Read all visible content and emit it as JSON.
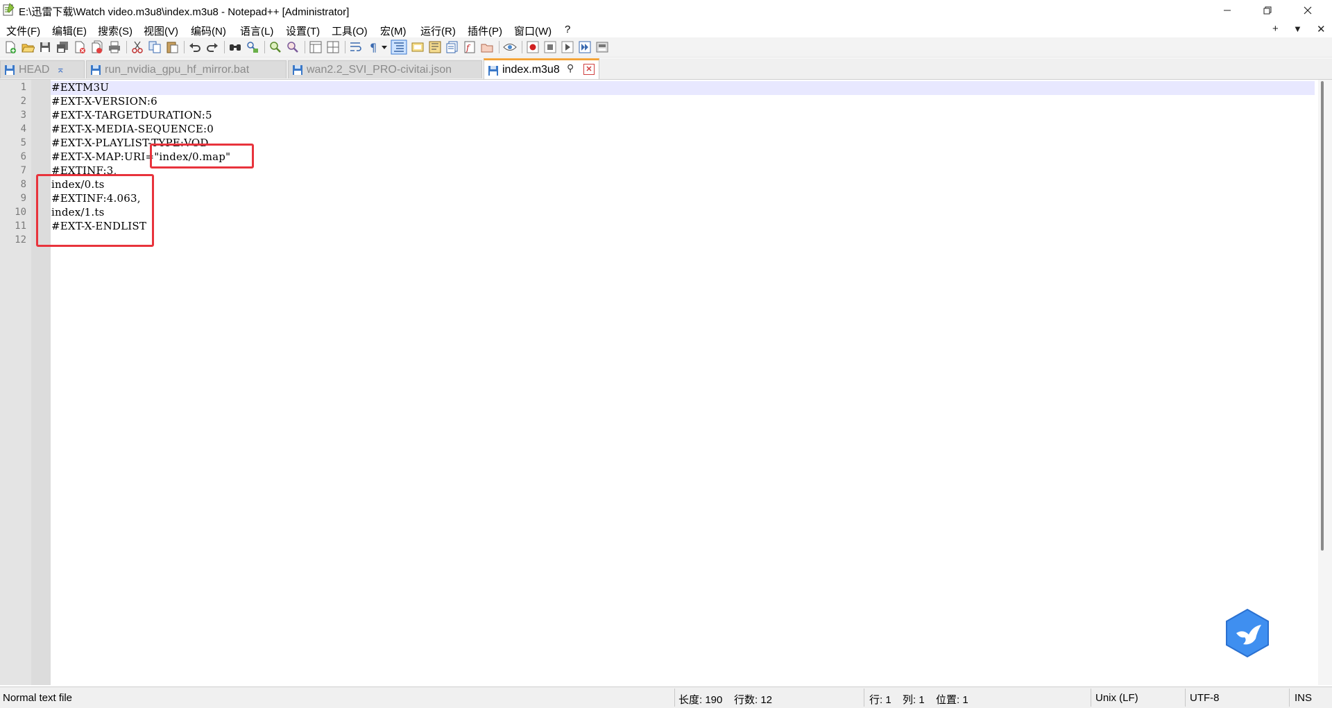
{
  "window": {
    "title": "E:\\迅雷下载\\Watch video.m3u8\\index.m3u8 - Notepad++ [Administrator]",
    "minimize_icon": "minimize-icon",
    "restore_icon": "restore-icon",
    "close_icon": "close-icon"
  },
  "menu": {
    "items": [
      "文件(F)",
      "编辑(E)",
      "搜索(S)",
      "视图(V)",
      "编码(N)",
      "语言(L)",
      "设置(T)",
      "工具(O)",
      "宏(M)",
      "运行(R)",
      "插件(P)",
      "窗口(W)",
      "?"
    ],
    "plus": "+",
    "dropdown": "▼",
    "close": "✕"
  },
  "tabs": [
    {
      "label": "HEAD",
      "pin": "⌅",
      "active": false
    },
    {
      "label": "run_nvidia_gpu_hf_mirror.bat",
      "active": false
    },
    {
      "label": "wan2.2_SVI_PRO-civitai.json",
      "active": false
    },
    {
      "label": "index.m3u8",
      "pin": "⚲",
      "close": "✕",
      "active": true
    }
  ],
  "editor": {
    "line_numbers": [
      "1",
      "2",
      "3",
      "4",
      "5",
      "6",
      "7",
      "8",
      "9",
      "10",
      "11",
      "12"
    ],
    "lines": [
      "#EXTM3U",
      "#EXT-X-VERSION:6",
      "#EXT-X-TARGETDURATION:5",
      "#EXT-X-MEDIA-SEQUENCE:0",
      "#EXT-X-PLAYLIST-TYPE:VOD",
      "#EXT-X-MAP:URI=\"index/0.map\"",
      "#EXTINF:3,",
      "index/0.ts",
      "#EXTINF:4.063,",
      "index/1.ts",
      "#EXT-X-ENDLIST",
      ""
    ]
  },
  "status": {
    "file_type": "Normal text file",
    "length": "长度: 190",
    "lines": "行数: 12",
    "row": "行: 1",
    "col": "列: 1",
    "pos": "位置: 1",
    "eol": "Unix (LF)",
    "encoding": "UTF-8",
    "mode": "INS"
  },
  "colors": {
    "highlight_box": "#e8333c",
    "active_tab_accent": "#f2a33a",
    "current_line": "#e8e8ff"
  }
}
